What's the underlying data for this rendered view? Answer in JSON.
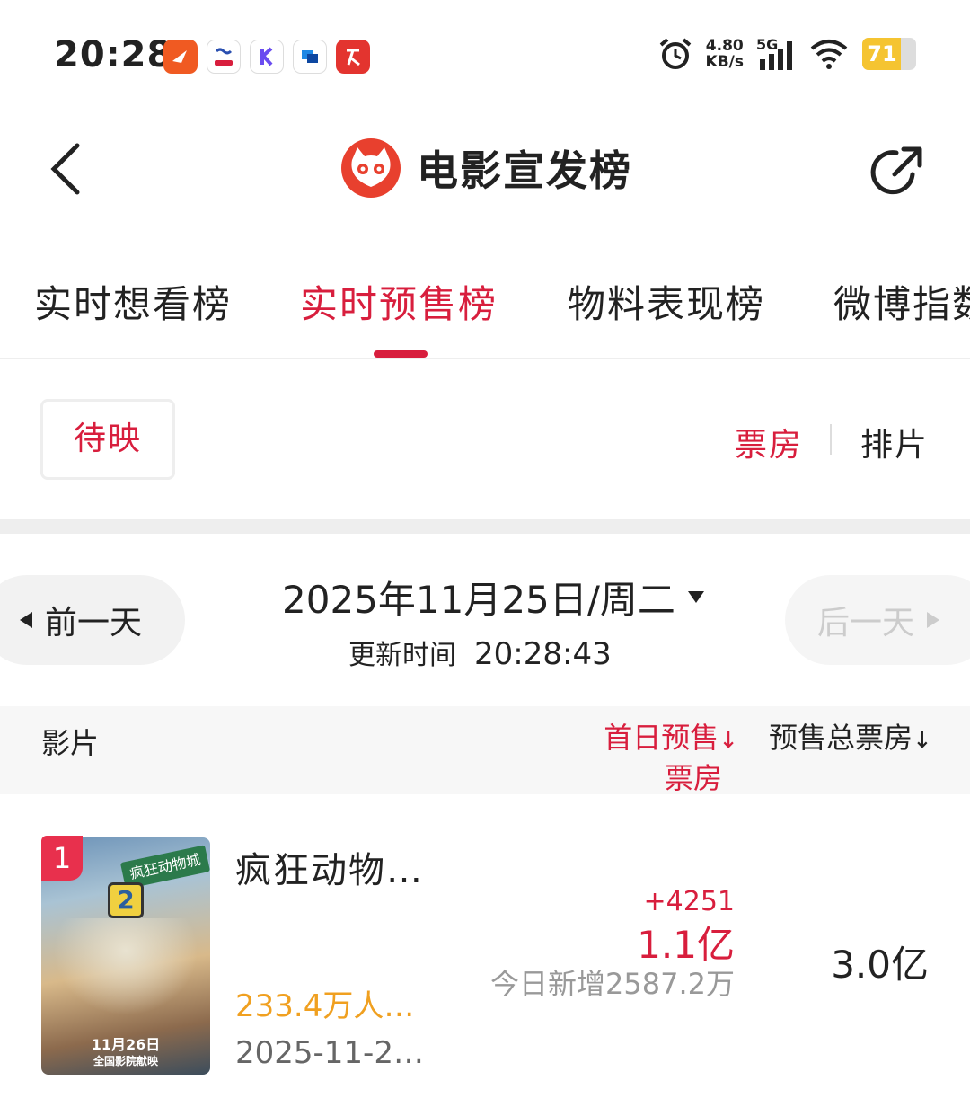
{
  "status_bar": {
    "time": "20:28",
    "net_speed_value": "4.80",
    "net_speed_unit": "KB/s",
    "network_type": "5G",
    "battery": "71",
    "battery_level": 0.71
  },
  "header": {
    "title": "电影宣发榜"
  },
  "tabs": [
    {
      "label": "实时想看榜",
      "active": false
    },
    {
      "label": "实时预售榜",
      "active": true
    },
    {
      "label": "物料表现榜",
      "active": false
    },
    {
      "label": "微博指数",
      "active": false
    }
  ],
  "filter": {
    "chip": "待映",
    "seg_box_office": "票房",
    "seg_schedule": "排片"
  },
  "date_nav": {
    "prev": "前一天",
    "next": "后一天",
    "date": "2025年11月25日/周二",
    "update_label": "更新时间",
    "update_time": "20:28:43"
  },
  "table_header": {
    "film": "影片",
    "first_day_line1": "首日预售",
    "first_day_line2": "票房",
    "total": "预售总票房",
    "sort_arrow": "↓"
  },
  "rows": [
    {
      "rank": "1",
      "title": "疯狂动物…",
      "want": "233.4万人…",
      "release": "2025-11-2…",
      "increase": "+4251",
      "first_day": "1.1亿",
      "today_new": "今日新增2587.2万",
      "total": "3.0亿",
      "poster_sign": "疯狂动物城",
      "poster_number": "2",
      "poster_date_line1": "11月26日",
      "poster_date_line2": "全国影院献映"
    }
  ],
  "colors": {
    "accent": "#d81e3d",
    "want_orange": "#f0a020",
    "muted": "#999999"
  }
}
